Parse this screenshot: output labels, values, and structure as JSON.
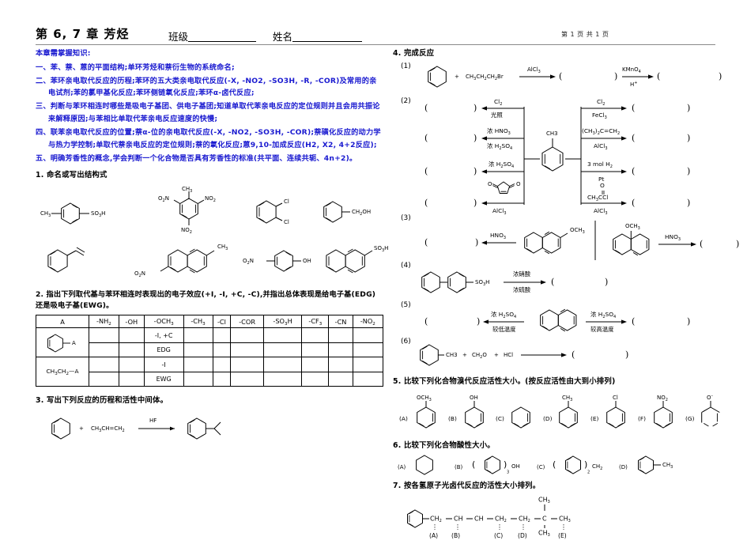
{
  "header": {
    "title": "第 6, 7 章  芳烃",
    "field_class_label": "班级",
    "field_name_label": "姓名",
    "page_indicator": "第 1 页  共 1 页"
  },
  "key_points": {
    "heading": "本章需掌握知识:",
    "items": [
      "一、苯、萘、蒽的平面结构;单环芳烃和萘衍生物的系统命名;",
      "二、苯环亲电取代反应的历程;苯环的五大类亲电取代反应(-X, -NO2, -SO3H, -R, -COR)及常用的亲电试剂;苯的氯甲基化反应;苯环侧链氧化反应;苯环α-卤代反应;",
      "三、判断与苯环相连时哪些是吸电子基团、供电子基团;知道单取代苯亲电反应的定位规则并且会用共振论来解释原因;与苯相比单取代苯亲电反应速度的快慢;",
      "四、联苯亲电取代反应的位置;萘α-位的亲电取代反应(-X, -NO2, -SO3H, -COR);萘磺化反应的动力学与热力学控制;单取代萘亲电反应的定位规则;萘的氧化反应;蒽9,10-加成反应(H2, X2, 4+2反应);",
      "五、明确芳香性的概念,学会判断一个化合物是否具有芳香性的标准(共平面、连续共轭、4n+2)。"
    ]
  },
  "q1": {
    "title": "1. 命名或写出结构式",
    "row1": [
      {
        "name": "p-toluenesulfonic-acid",
        "left": "CH3",
        "right": "SO3H"
      },
      {
        "name": "trinitrotoluene",
        "top": "CH3",
        "left": "O2N",
        "right": "NO2",
        "bottom": "NO2"
      },
      {
        "name": "o-dichlorobenzene",
        "sub1": "Cl",
        "sub2": "Cl"
      },
      {
        "name": "benzyl-alcohol",
        "right": "CH2OH"
      }
    ],
    "row2": [
      {
        "name": "styrene",
        "right": ""
      },
      {
        "name": "nitro-methyl-naphthalene",
        "right": "CH3",
        "left": "O2N"
      },
      {
        "name": "p-nitrophenol",
        "left": "O2N",
        "right": "OH"
      },
      {
        "name": "naphthalene-sulfonic-acid",
        "right": "SO3H"
      }
    ]
  },
  "q2": {
    "title_line1": "2. 指出下列取代基与苯环相连时表现出的电子效应(+I, -I, +C, -C),并指出总体表现是给电子基(EDG)",
    "title_line2": "还是吸电子基(EWG)。",
    "headers": [
      "A",
      "-NH2",
      "-OH",
      "-OCH3",
      "-CH3",
      "-Cl",
      "-COR",
      "-SO3H",
      "-CF3",
      "-CN",
      "-NO2"
    ],
    "row_label_1": "phenyl-A",
    "row_label_2": "CH3CH2—A",
    "filled": {
      "r1c3a": "-I, +C",
      "r1c3b": "EDG",
      "r2c3a": "-I",
      "r2c3b": "EWG"
    }
  },
  "q3": {
    "title": "3. 写出下列反应的历程和活性中间体。",
    "reagent_left": "CH3CH=CH2",
    "catalyst": "HF",
    "plus": "+"
  },
  "q4": {
    "title": "4. 完成反应",
    "item1": {
      "num": "(1)",
      "reagent": "CH3CH2CH2Br",
      "cat1": "AlCl3",
      "cat2_top": "KMnO4",
      "cat2_bot": "H+",
      "plus": "+"
    },
    "item2": {
      "num": "(2)",
      "core": "CH3",
      "left_reagents": [
        {
          "top": "Cl2",
          "bottom": "光照"
        },
        {
          "top": "浓 HNO3",
          "bottom": "浓 H2SO4"
        },
        {
          "top": "浓 H2SO4",
          "bottom": ""
        },
        {
          "top": "maleic-anhydride",
          "bottom": "AlCl3"
        }
      ],
      "right_reagents": [
        {
          "top": "Cl2",
          "bottom": "FeCl3"
        },
        {
          "top": "(CH3)2C=CH2",
          "bottom": "AlCl3"
        },
        {
          "top": "3 mol H2",
          "bottom": "Pt"
        },
        {
          "top": "CH3CCl",
          "bottom": "AlCl3",
          "extra": "O"
        }
      ]
    },
    "item3": {
      "num": "(3)",
      "reagent": "HNO3",
      "sub_a": "OCH3",
      "sub_b": "OCH3"
    },
    "item4": {
      "num": "(4)",
      "sub": "SO3H",
      "cat_top": "浓硝酸",
      "cat_bot": "浓硫酸"
    },
    "item5": {
      "num": "(5)",
      "left_top": "浓 H2SO4",
      "left_bot": "较低温度",
      "right_top": "浓 H2SO4",
      "right_bot": "较高温度"
    },
    "item6": {
      "num": "(6)",
      "sub": "CH3",
      "r1": "CH2O",
      "r2": "HCl",
      "plus": "+"
    }
  },
  "q5": {
    "title": "5. 比较下列化合物溴代反应活性大小。(按反应活性由大到小排列)",
    "compounds": [
      {
        "tag": "(A)",
        "sub": "OCH3"
      },
      {
        "tag": "(B)",
        "sub": "OH"
      },
      {
        "tag": "(C)",
        "sub": ""
      },
      {
        "tag": "(D)",
        "sub": "CH3"
      },
      {
        "tag": "(E)",
        "sub": "Cl"
      },
      {
        "tag": "(F)",
        "sub": "NO2"
      },
      {
        "tag": "(G)",
        "sub": "O-"
      }
    ]
  },
  "q6": {
    "title": "6.   比较下列化合物酸性大小。",
    "compounds": [
      {
        "tag": "(A)",
        "sub": "",
        "n": ""
      },
      {
        "tag": "(B)",
        "sub": "OH",
        "n": "3"
      },
      {
        "tag": "(C)",
        "sub": "CH2",
        "n": "2"
      },
      {
        "tag": "(D)",
        "sub": "CH3",
        "n": ""
      }
    ]
  },
  "q7": {
    "title": "7. 按各氢原子光卤代反应的活性大小排列。",
    "chain": [
      "CH2",
      "CH",
      "CH",
      "CH2",
      "CH2",
      "C",
      "CH3"
    ],
    "branch_top": "CH3",
    "branch_bot": "CH3",
    "tags": [
      "(A)",
      "(B)",
      "(C)",
      "(D)",
      "(E)"
    ]
  },
  "colors": {
    "blue": "#1a1ad0",
    "rule": "#8a8a8a",
    "ink": "#000000"
  }
}
